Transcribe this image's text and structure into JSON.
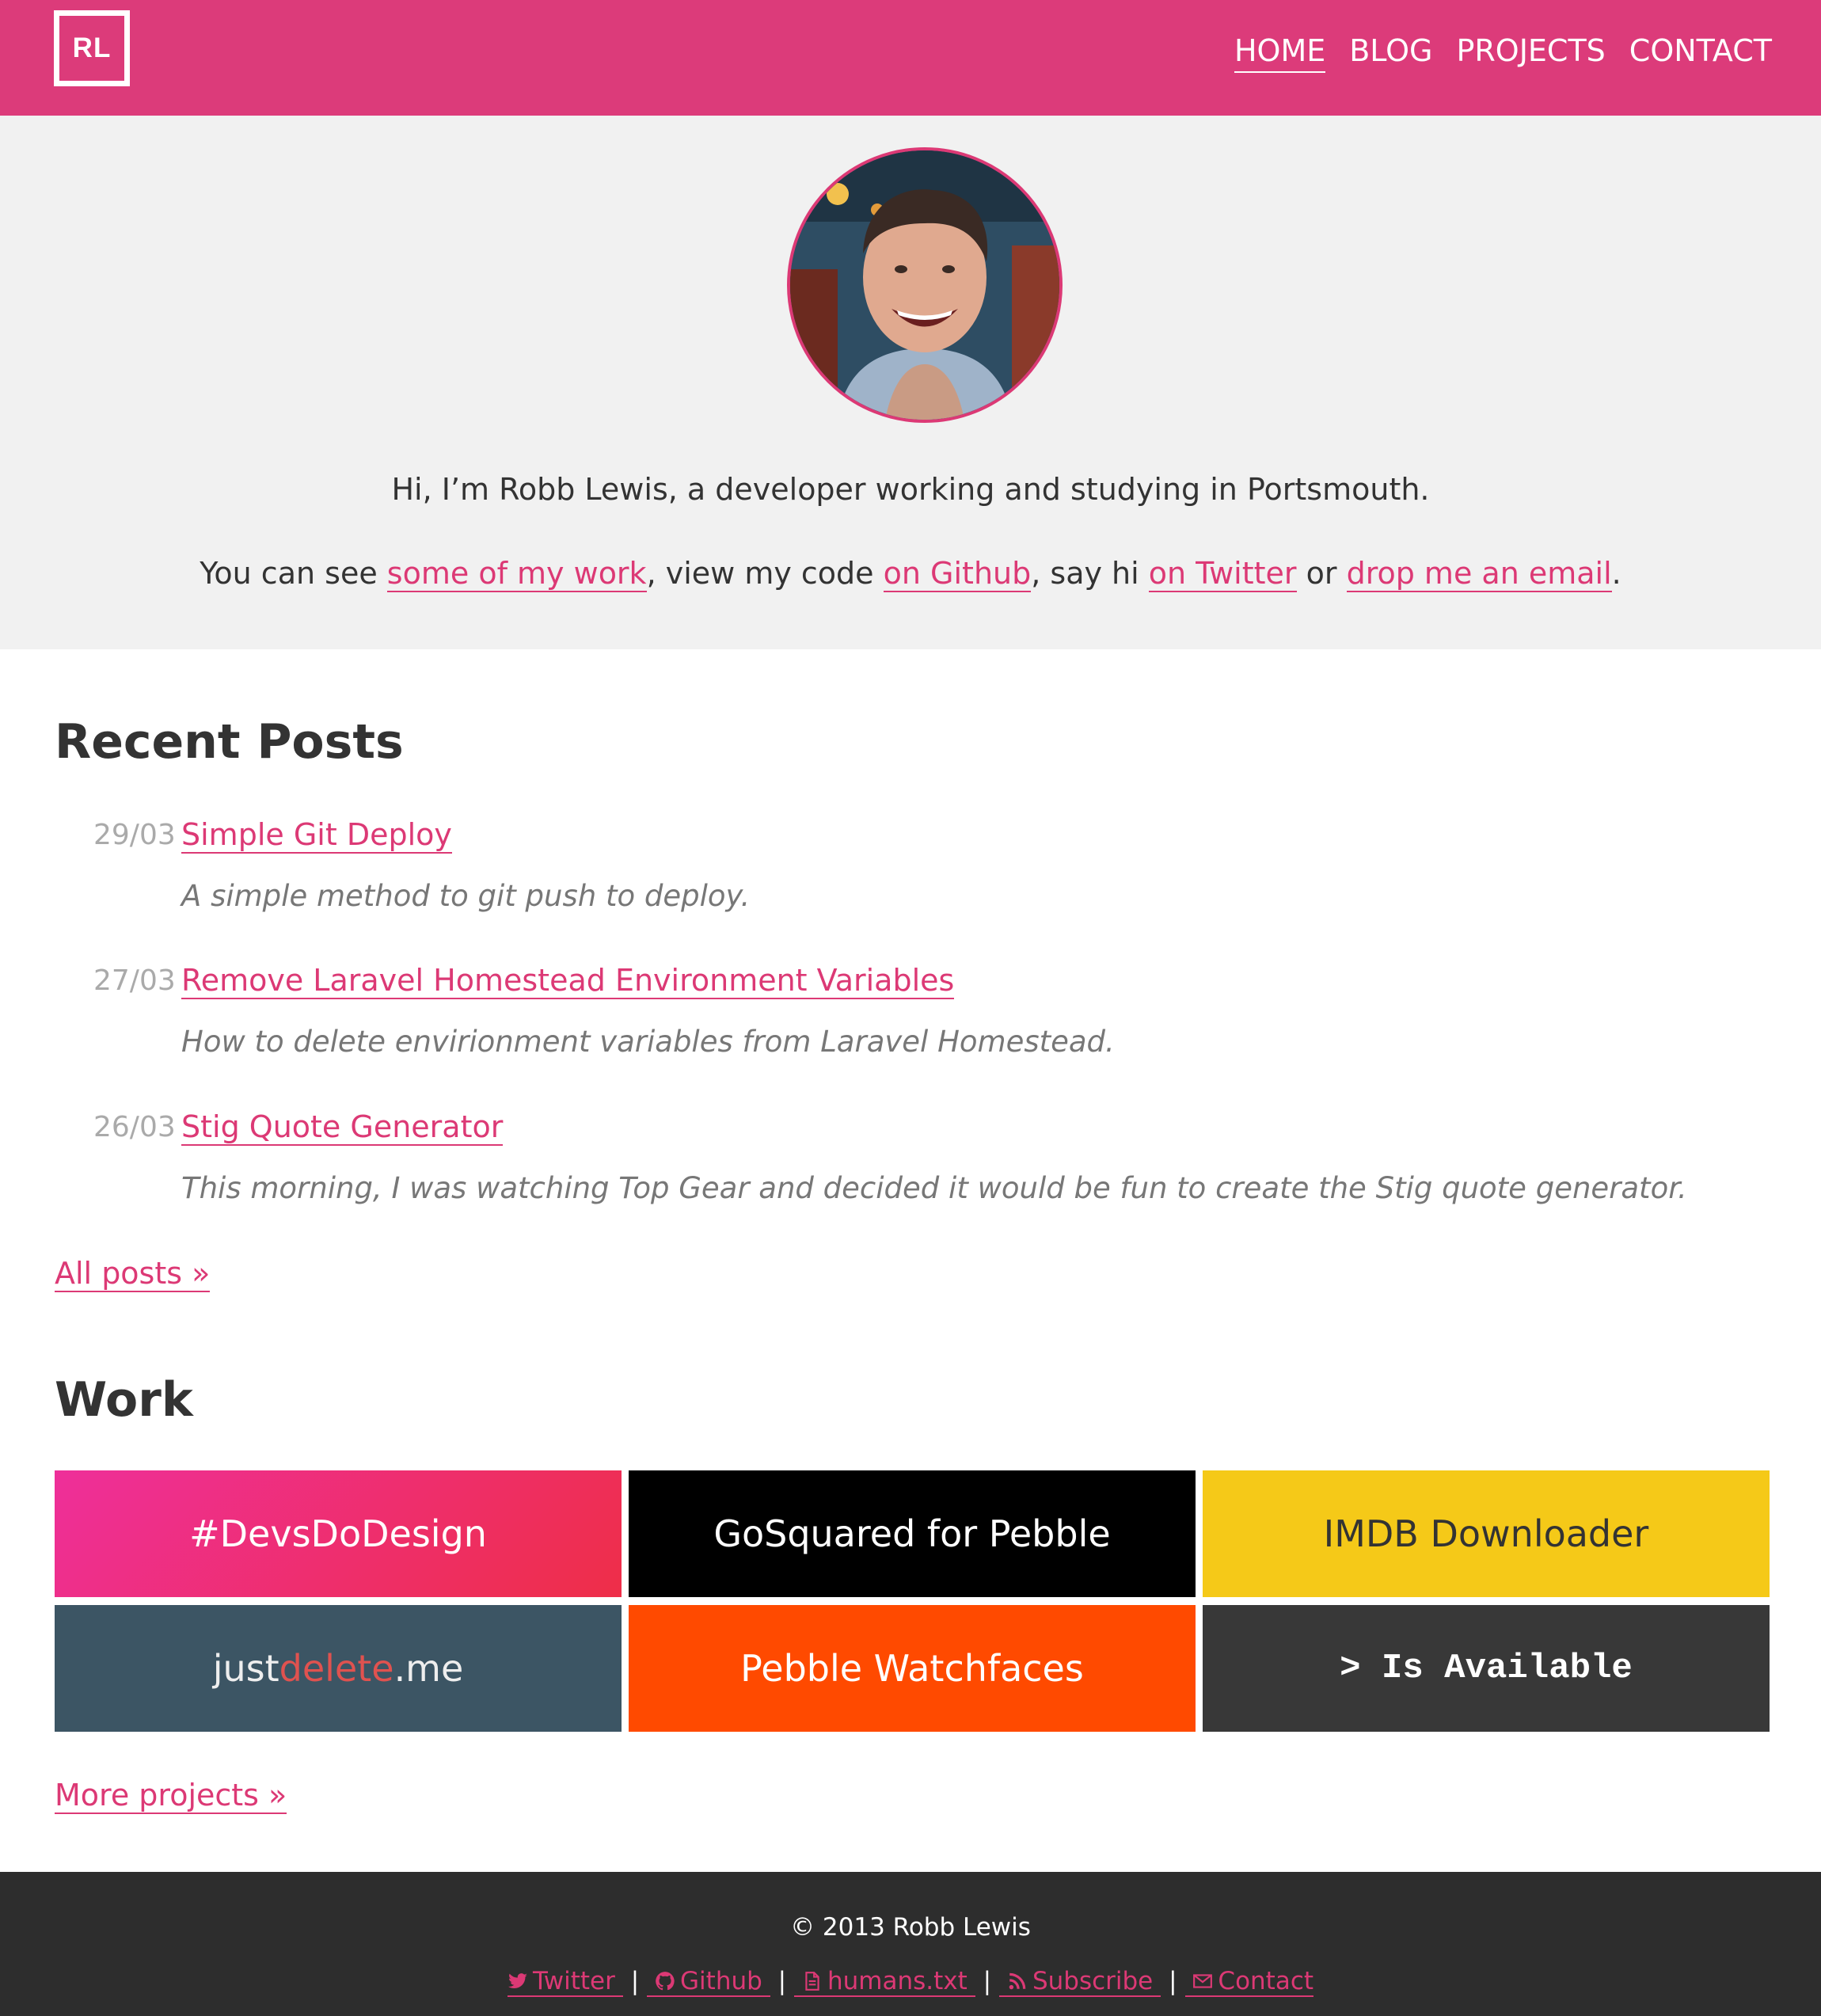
{
  "header": {
    "logo": "RL",
    "nav": [
      "HOME",
      "BLOG",
      "PROJECTS",
      "CONTACT"
    ],
    "active_nav": "HOME"
  },
  "intro": {
    "line1": "Hi, I’m Robb Lewis, a developer working and studying in Portsmouth.",
    "l2_a": "You can see ",
    "l2_link1": "some of my work",
    "l2_b": ", view my code ",
    "l2_link2": "on Github",
    "l2_c": ", say hi ",
    "l2_link3": "on Twitter",
    "l2_d": " or ",
    "l2_link4": "drop me an email",
    "l2_e": "."
  },
  "recent_posts": {
    "title": "Recent Posts",
    "items": [
      {
        "date": "29/03",
        "title": "Simple Git Deploy",
        "desc": "A simple method to git push to deploy."
      },
      {
        "date": "27/03",
        "title": "Remove Laravel Homestead Environment Variables",
        "desc": "How to delete envirionment variables from Laravel Homestead."
      },
      {
        "date": "26/03",
        "title": "Stig Quote Generator",
        "desc": "This morning, I was watching Top Gear and decided it would be fun to create the Stig quote generator."
      }
    ],
    "all_posts": "All posts »"
  },
  "work": {
    "title": "Work",
    "tiles": [
      {
        "label": "#DevsDoDesign",
        "bg": "#ee2f8f"
      },
      {
        "label": "GoSquared for Pebble",
        "bg": "#000000"
      },
      {
        "label": "IMDB Downloader",
        "bg": "#f5c918"
      },
      {
        "label_a": "just",
        "label_b": "delete",
        "label_c": ".me",
        "bg": "#3c5564"
      },
      {
        "label": "Pebble Watchfaces",
        "bg": "#ff4a00"
      },
      {
        "label": "> Is Available",
        "bg": "#383838"
      }
    ],
    "more_projects": "More projects »"
  },
  "footer": {
    "copyright": "© 2013 Robb Lewis",
    "links": [
      "Twitter",
      "Github",
      "humans.txt",
      "Subscribe",
      "Contact"
    ],
    "separator": "|"
  },
  "colors": {
    "brand_pink": "#dc3b7a",
    "intro_bg": "#f1f1f1",
    "footer_bg": "#2d2d2d"
  }
}
